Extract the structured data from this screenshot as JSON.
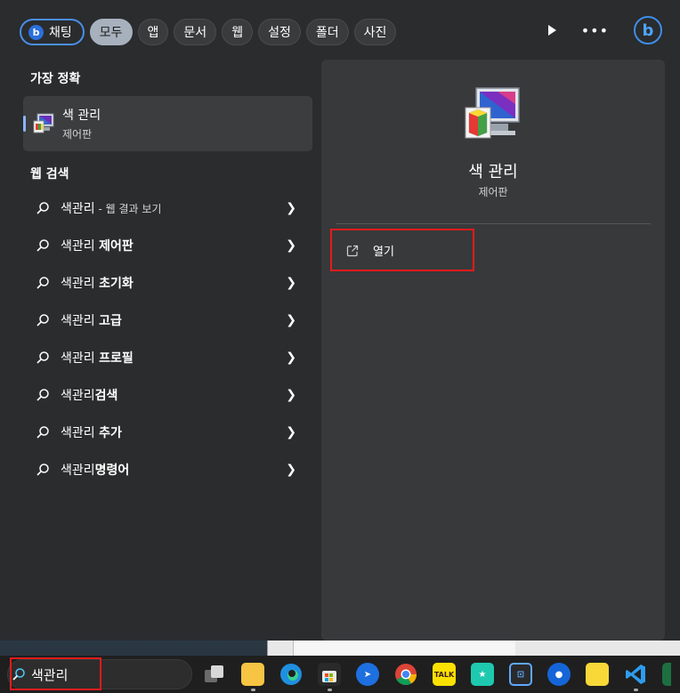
{
  "filters": {
    "chat": "채팅",
    "all": "모두",
    "apps": "앱",
    "documents": "문서",
    "web": "웹",
    "settings": "설정",
    "folders": "폴더",
    "photos": "사진"
  },
  "best_match": {
    "heading": "가장 정확",
    "title": "색 관리",
    "subtitle": "제어판"
  },
  "web_search": {
    "heading": "웹 검색",
    "items": [
      {
        "prefix": "색관리",
        "hint": " - 웹 결과 보기",
        "suffix": ""
      },
      {
        "prefix": "색관리 ",
        "hint": "",
        "suffix": "제어판"
      },
      {
        "prefix": "색관리 ",
        "hint": "",
        "suffix": "초기화"
      },
      {
        "prefix": "색관리 ",
        "hint": "",
        "suffix": "고급"
      },
      {
        "prefix": "색관리 ",
        "hint": "",
        "suffix": "프로필"
      },
      {
        "prefix": "색관리",
        "hint": "",
        "suffix": "검색"
      },
      {
        "prefix": "색관리 ",
        "hint": "",
        "suffix": "추가"
      },
      {
        "prefix": "색관리",
        "hint": "",
        "suffix": "명령어"
      }
    ]
  },
  "detail": {
    "title": "색 관리",
    "subtitle": "제어판",
    "open_label": "열기"
  },
  "taskbar": {
    "search_value": "색관리"
  },
  "colors": {
    "accent_red": "#e51b1b",
    "bing_blue": "#2b6fdc"
  }
}
